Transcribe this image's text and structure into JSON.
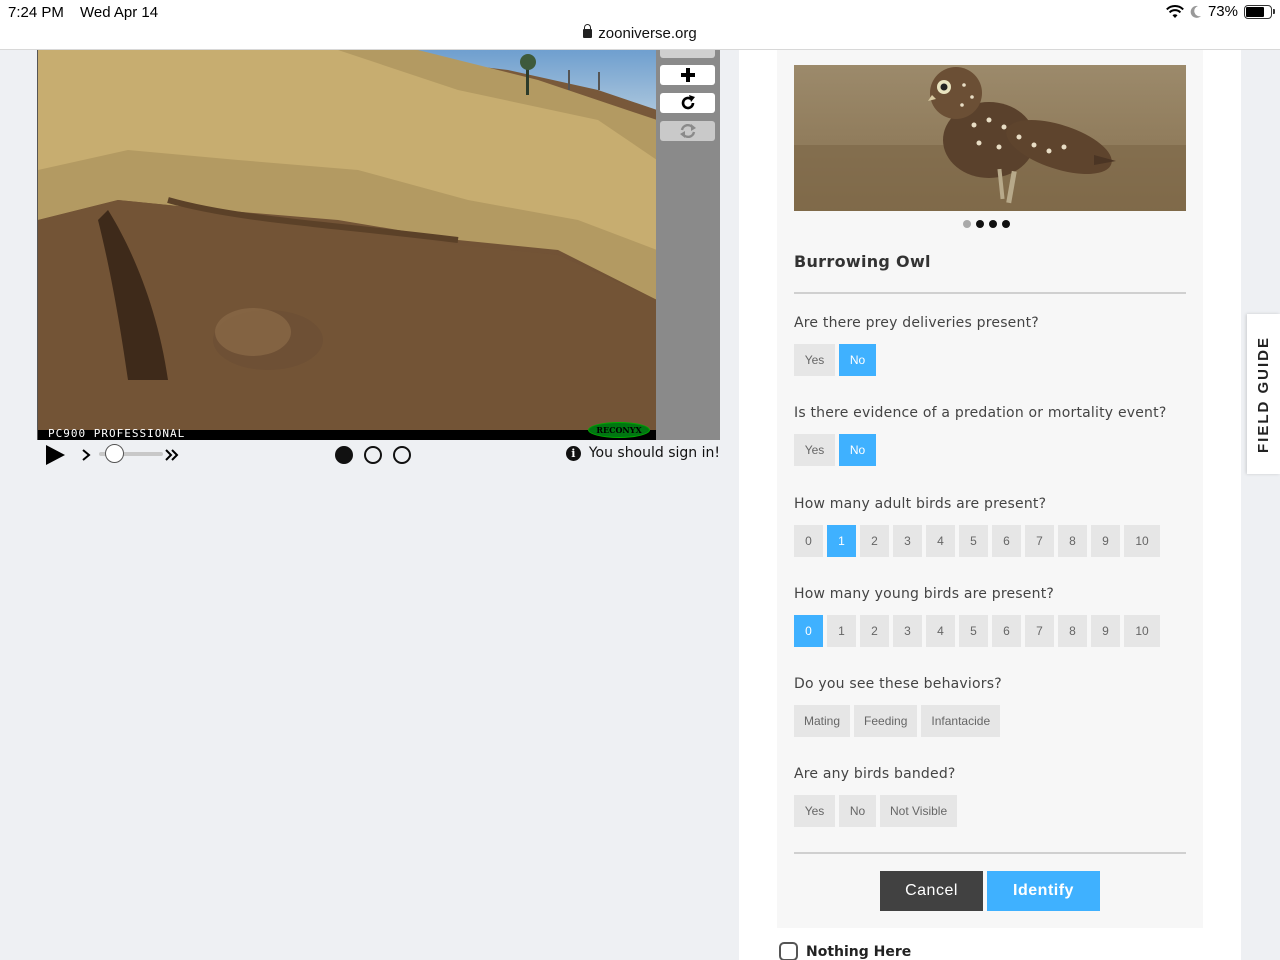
{
  "status_bar": {
    "time": "7:24 PM",
    "date": "Wed Apr 14",
    "url": "zooniverse.org",
    "battery": "73%",
    "battery_level": 0.73
  },
  "viewer": {
    "photo_caption": "PC900 PROFESSIONAL",
    "camera_brand": "RECONYX",
    "tools": [
      "plus-icon",
      "rotate-icon",
      "reset-icon"
    ],
    "frames": {
      "count": 3,
      "active": 0
    },
    "sign_in_message": "You should sign in!"
  },
  "task": {
    "guide_carousel": {
      "count": 4,
      "active": 1
    },
    "species_name": "Burrowing Owl",
    "questions": [
      {
        "text": "Are there prey deliveries present?",
        "options": [
          "Yes",
          "No"
        ],
        "selected": "No"
      },
      {
        "text": "Is there evidence of a predation or mortality event?",
        "options": [
          "Yes",
          "No"
        ],
        "selected": "No"
      },
      {
        "text": "How many adult birds are present?",
        "options": [
          "0",
          "1",
          "2",
          "3",
          "4",
          "5",
          "6",
          "7",
          "8",
          "9",
          "10"
        ],
        "selected": "1"
      },
      {
        "text": "How many young birds are present?",
        "options": [
          "0",
          "1",
          "2",
          "3",
          "4",
          "5",
          "6",
          "7",
          "8",
          "9",
          "10"
        ],
        "selected": "0"
      },
      {
        "text": "Do you see these behaviors?",
        "options": [
          "Mating",
          "Feeding",
          "Infantacide"
        ],
        "selected": null
      },
      {
        "text": "Are any birds banded?",
        "options": [
          "Yes",
          "No",
          "Not Visible"
        ],
        "selected": null
      }
    ],
    "cancel_label": "Cancel",
    "identify_label": "Identify",
    "nothing_here_label": "Nothing Here"
  },
  "field_guide_label": "FIELD GUIDE",
  "colors": {
    "accent": "#3fb1ff",
    "cancel_bg": "#414141",
    "option_bg": "#e6e6e6",
    "panel_bg": "#f7f7f7",
    "page_bg": "#eef0f3"
  }
}
